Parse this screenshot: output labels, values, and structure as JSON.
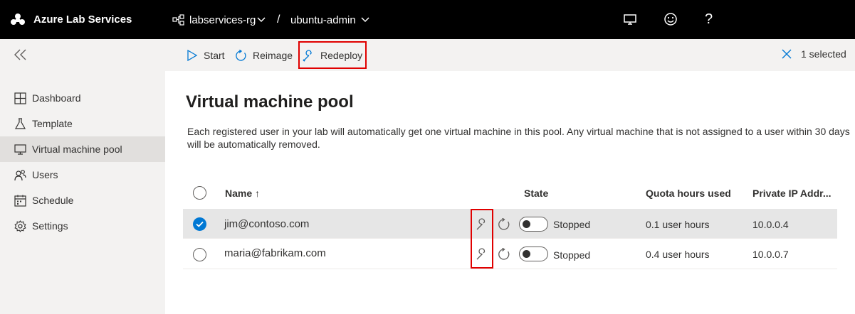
{
  "topbar": {
    "app_title": "Azure Lab Services",
    "resource_group": "labservices-rg",
    "separator": "/",
    "lab_name": "ubuntu-admin",
    "icons": [
      "monitor-icon",
      "smiley-icon",
      "help-icon"
    ],
    "help_glyph": "?"
  },
  "commandbar": {
    "start_label": "Start",
    "reimage_label": "Reimage",
    "redeploy_label": "Redeploy",
    "selection_status": "1 selected"
  },
  "sidebar": {
    "items": [
      {
        "label": "Dashboard",
        "icon": "dashboard-icon",
        "active": false
      },
      {
        "label": "Template",
        "icon": "flask-icon",
        "active": false
      },
      {
        "label": "Virtual machine pool",
        "icon": "monitor-icon",
        "active": true
      },
      {
        "label": "Users",
        "icon": "users-icon",
        "active": false
      },
      {
        "label": "Schedule",
        "icon": "calendar-icon",
        "active": false
      },
      {
        "label": "Settings",
        "icon": "gear-icon",
        "active": false
      }
    ]
  },
  "main": {
    "title": "Virtual machine pool",
    "description": "Each registered user in your lab will automatically get one virtual machine in this pool. Any virtual machine that is not assigned to a user within 30 days will be automatically removed.",
    "columns": {
      "name": "Name ↑",
      "state": "State",
      "quota": "Quota hours used",
      "ip": "Private IP Addr..."
    },
    "rows": [
      {
        "name": "jim@contoso.com",
        "state": "Stopped",
        "quota": "0.1 user hours",
        "ip": "10.0.0.4",
        "selected": true
      },
      {
        "name": "maria@fabrikam.com",
        "state": "Stopped",
        "quota": "0.4 user hours",
        "ip": "10.0.0.7",
        "selected": false
      }
    ]
  },
  "colors": {
    "accent": "#0078d4",
    "highlight": "#e00000",
    "topbar": "#000000"
  }
}
